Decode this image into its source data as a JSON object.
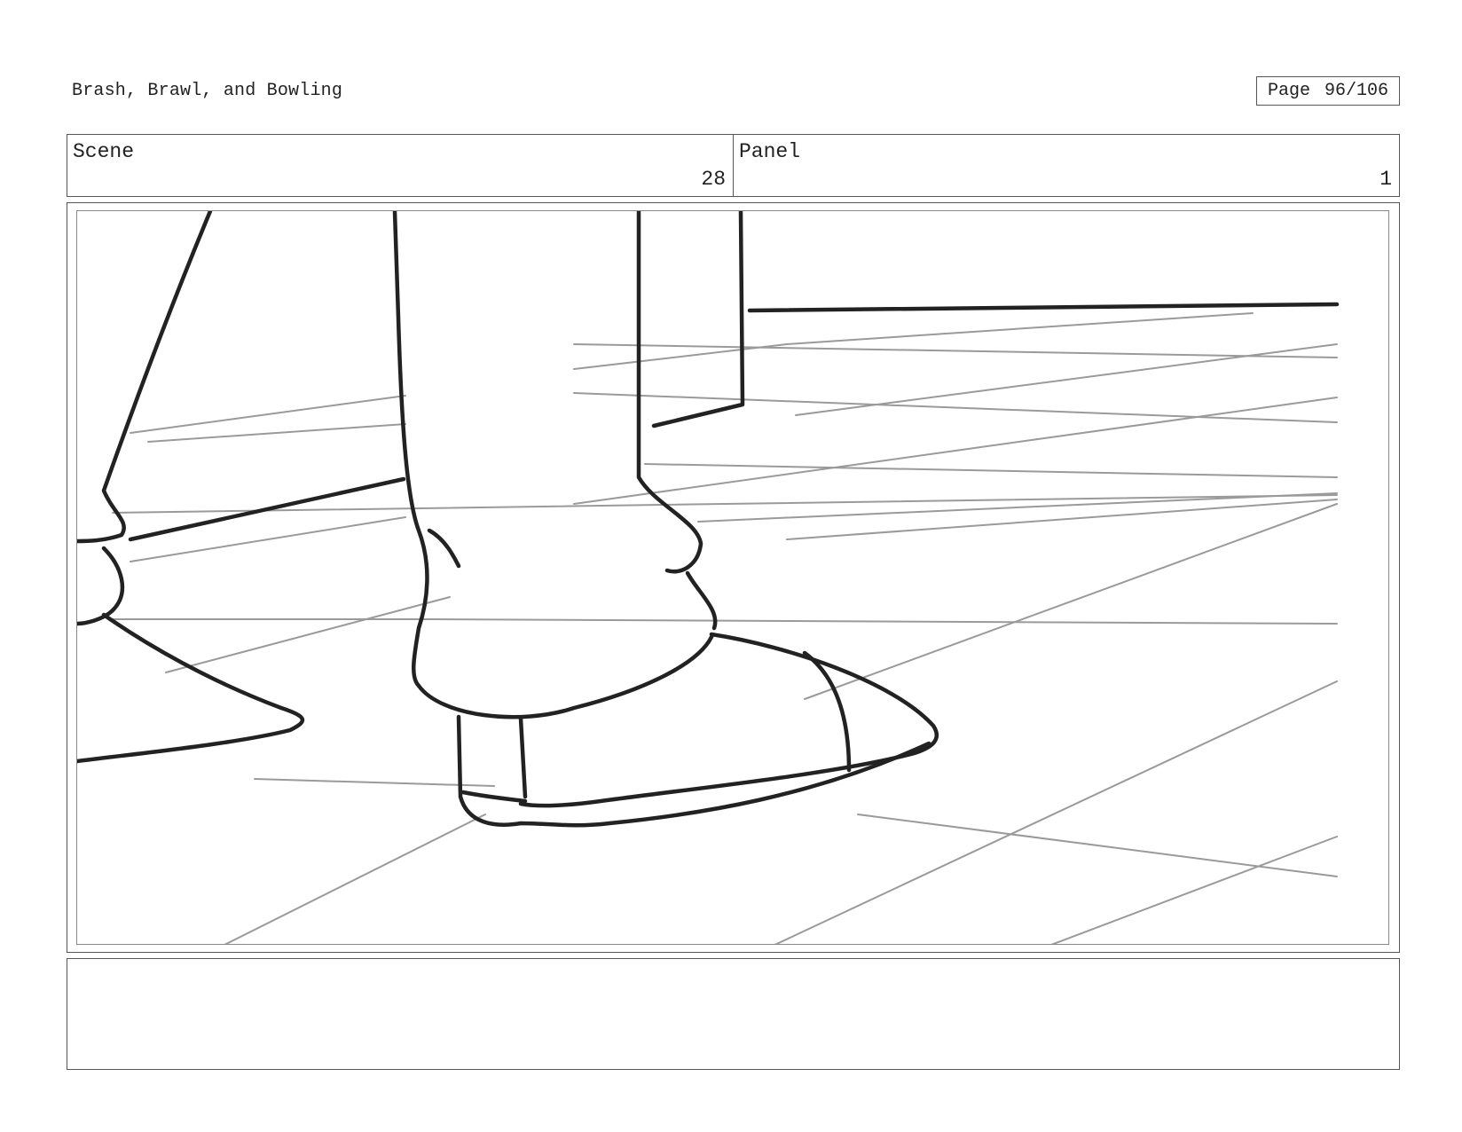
{
  "document": {
    "title": "Brash, Brawl, and Bowling",
    "page_label": "Page",
    "page_value": "96/106"
  },
  "header": {
    "scene_label": "Scene",
    "scene_value": "28",
    "panel_label": "Panel",
    "panel_value": "1"
  },
  "panel_image": {
    "icon": "storyboard-sketch",
    "description_hidden": true
  },
  "notes": {
    "text": ""
  },
  "colors": {
    "ink": "#222222",
    "guide": "#9a9a9a",
    "border": "#555555"
  }
}
